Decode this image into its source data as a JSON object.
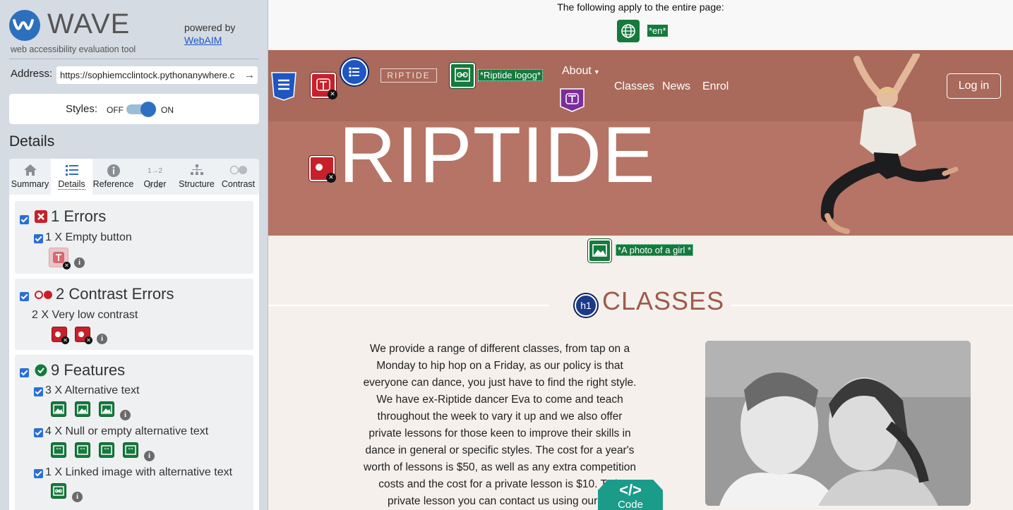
{
  "sidebar": {
    "logo_text": "WAVE",
    "logo_subtitle": "web accessibility evaluation tool",
    "powered_by": "powered by",
    "powered_by_link": "WebAIM",
    "address_label": "Address:",
    "address_value": "https://sophiemcclintock.pythonanywhere.c",
    "styles_label": "Styles:",
    "styles_off": "OFF",
    "styles_on": "ON",
    "details_heading": "Details",
    "tabs": [
      {
        "label": "Summary",
        "icon": "home-icon"
      },
      {
        "label": "Details",
        "icon": "list-icon"
      },
      {
        "label": "Reference",
        "icon": "info-icon"
      },
      {
        "label": "Order",
        "icon": "order-icon"
      },
      {
        "label": "Structure",
        "icon": "structure-icon"
      },
      {
        "label": "Contrast",
        "icon": "contrast-icon"
      }
    ],
    "errors": {
      "title": "1 Errors",
      "items": [
        {
          "label": "1 X Empty button"
        }
      ]
    },
    "contrast": {
      "title": "2 Contrast Errors",
      "items": [
        {
          "label": "2 X Very low contrast"
        }
      ]
    },
    "features": {
      "title": "9 Features",
      "items": [
        {
          "label": "3 X Alternative text"
        },
        {
          "label": "4 X Null or empty alternative text"
        },
        {
          "label": "1 X Linked image with alternative text"
        }
      ]
    }
  },
  "page": {
    "apply_text": "The following apply to the entire page:",
    "lang_tag": "*en*",
    "nav": {
      "logo_text": "RIPTIDE",
      "logo_alt": "*Riptide logog*",
      "about": "About",
      "links": [
        "Classes",
        "News",
        "Enrol"
      ],
      "login": "Log in"
    },
    "hero_title": "RIPTIDE",
    "photo_alt": "*A photo of a girl *",
    "h1_badge": "h1",
    "classes_heading": "CLASSES",
    "body_lines": [
      "We provide a range of different classes, from tap on a",
      "Monday to hip hop on a Friday, as our policy is that",
      "everyone can dance, you just have to find the right style.",
      "We have ex-Riptide dancer Eva to come and teach",
      "throughout the week to vary it up and we also offer",
      "private lessons for those keen to improve their skills in",
      "dance in general or specific styles. The cost for a year's",
      "worth of lessons is $50, as well as any extra competition",
      "costs and the cost for a private lesson is $10. To b",
      "private lesson you can contact us using our co"
    ],
    "code_glyph": "</>",
    "code_label": "Code"
  },
  "colors": {
    "sidebar_bg": "#d4dbe3",
    "nav_bg": "#a9695b",
    "hero_bg": "#b57466",
    "heading": "#9e5a4c",
    "wave_green": "#147a3d",
    "wave_red": "#c8202a",
    "code_tab": "#1b9b8a"
  }
}
